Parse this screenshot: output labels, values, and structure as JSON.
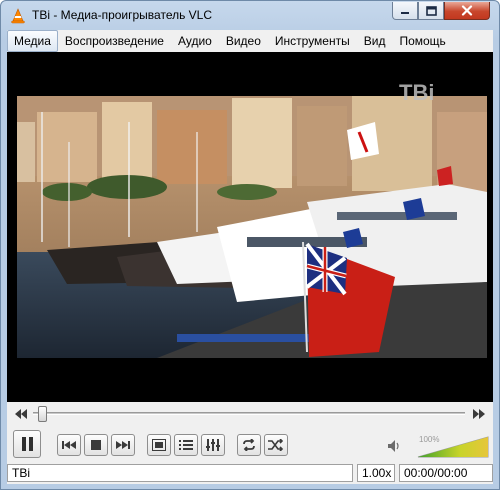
{
  "window": {
    "title": "TBi - Медиа-проигрыватель VLC",
    "accent": "#ff8800"
  },
  "menu": [
    {
      "label": "Медиа",
      "active": true
    },
    {
      "label": "Воспроизведение"
    },
    {
      "label": "Аудио"
    },
    {
      "label": "Видео"
    },
    {
      "label": "Инструменты"
    },
    {
      "label": "Вид"
    },
    {
      "label": "Помощь"
    }
  ],
  "video": {
    "channel_logo": "TBi",
    "scene": "harbor-with-yachts-and-flags"
  },
  "seek": {
    "progress": 0.01
  },
  "controls": {
    "play_pause_icon": "pause-icon",
    "prev_icon": "previous-icon",
    "stop_icon": "stop-icon",
    "next_icon": "next-icon",
    "fullscreen_icon": "fullscreen-icon",
    "extended_icon": "extended-settings-icon",
    "playlist_icon": "playlist-icon",
    "loop_icon": "loop-icon",
    "shuffle_icon": "shuffle-icon"
  },
  "volume": {
    "percent_label": "100%",
    "level": 1.0,
    "icon": "speaker-icon"
  },
  "status": {
    "media_name": "TBi",
    "speed": "1.00x",
    "time": "00:00/00:00"
  }
}
